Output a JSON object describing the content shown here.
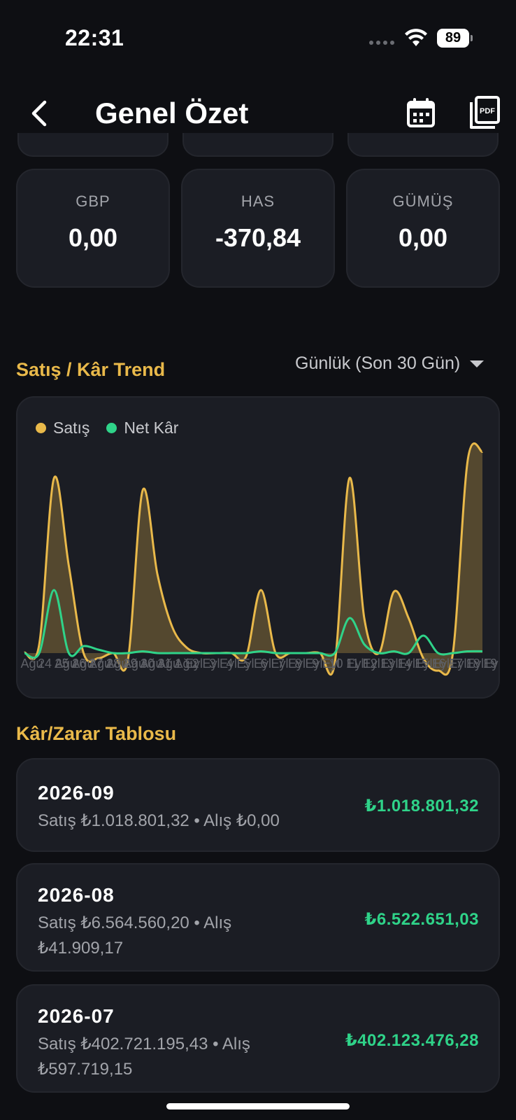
{
  "status_bar": {
    "time": "22:31",
    "battery": "89"
  },
  "header": {
    "title": "Genel Özet",
    "back_icon": "chevron-left-icon",
    "calendar_icon": "calendar-icon",
    "pdf_icon": "pdf-icon",
    "pdf_label": "PDF"
  },
  "currency_cards": [
    {
      "label": "GBP",
      "value": "0,00"
    },
    {
      "label": "HAS",
      "value": "-370,84"
    },
    {
      "label": "GÜMÜŞ",
      "value": "0,00"
    }
  ],
  "trend": {
    "section_title": "Satış / Kâr Trend",
    "period_selector": "Günlük (Son 30 Gün)"
  },
  "chart_data": {
    "type": "area",
    "legend": [
      {
        "name": "Satış",
        "color": "#e9b94a"
      },
      {
        "name": "Net Kâr",
        "color": "#2fd389"
      }
    ],
    "x_tick_labels": [
      "23",
      "Ağu",
      "24 Ağu",
      "25 Ağu",
      "26 Ağu",
      "27 Ağu",
      "28 Ağu",
      "29 Ağu",
      "30 Ağu",
      "31 Ağu",
      "1 Eyl",
      "2 Eyl",
      "3 Eyl",
      "4 Eyl",
      "5 Eyl",
      "6 Eyl",
      "7 Eyl",
      "8 Eyl",
      "9 Eyl",
      "10 Eyl",
      "11 Eyl",
      "12 Eyl",
      "13 Eyl",
      "14 Eyl",
      "15 Eyl",
      "16 Eyl",
      "17 Eyl",
      "18 Eyl",
      "19 Eyl",
      "20 Eyl",
      "21 Eyl",
      "22 Eyl"
    ],
    "series": [
      {
        "name": "Satış",
        "values": [
          0.3,
          5,
          100,
          50,
          0,
          -3,
          0,
          -4,
          93,
          45,
          15,
          3,
          0,
          0,
          0,
          -2,
          36,
          0,
          0,
          0,
          0,
          -6,
          100,
          20,
          0,
          35,
          20,
          -3,
          -10,
          0,
          110,
          115
        ]
      },
      {
        "name": "Net Kâr",
        "values": [
          0,
          0,
          36,
          0,
          4,
          2,
          0,
          0,
          1,
          0,
          0,
          0,
          0,
          0,
          0,
          0,
          1,
          0,
          0,
          0,
          0,
          0,
          20,
          5,
          0,
          1,
          0,
          10,
          0,
          0,
          1,
          1
        ]
      }
    ],
    "grid": false,
    "legend_position": "top-left"
  },
  "profit_loss": {
    "section_title": "Kâr/Zarar Tablosu",
    "rows": [
      {
        "month": "2026-09",
        "detail": "Satış ₺1.018.801,32 • Alış ₺0,00",
        "total": "₺1.018.801,32"
      },
      {
        "month": "2026-08",
        "detail": "Satış ₺6.564.560,20 • Alış ₺41.909,17",
        "total": "₺6.522.651,03"
      },
      {
        "month": "2026-07",
        "detail": "Satış ₺402.721.195,43 • Alış ₺597.719,15",
        "total": "₺402.123.476,28"
      }
    ]
  }
}
